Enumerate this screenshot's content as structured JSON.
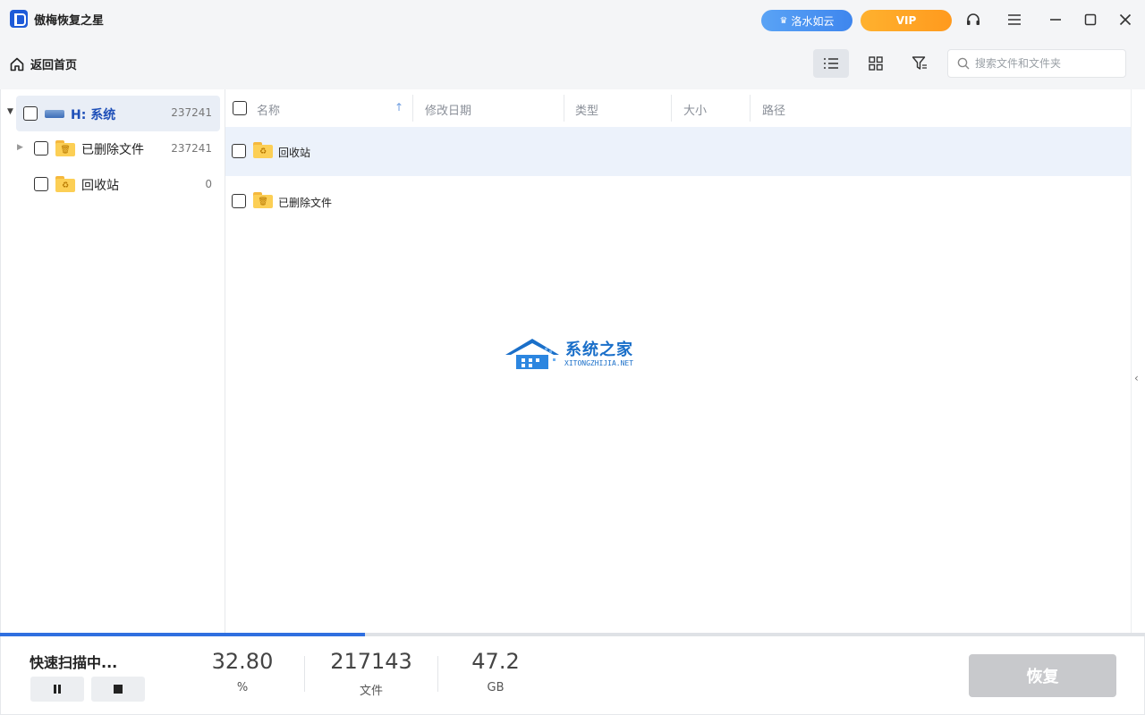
{
  "app": {
    "title": "傲梅恢复之星",
    "cloud_label": "洛水如云",
    "vip_label": "VIP"
  },
  "toolbar": {
    "home_label": "返回首页",
    "search_placeholder": "搜索文件和文件夹",
    "search_value": ""
  },
  "sidebar": {
    "drive": {
      "label": "H: 系统",
      "count": "237241"
    },
    "items": [
      {
        "label": "已删除文件",
        "count": "237241",
        "icon": "trash-folder-icon"
      },
      {
        "label": "回收站",
        "count": "0",
        "icon": "recycle-folder-icon"
      }
    ]
  },
  "filelist": {
    "columns": [
      "名称",
      "修改日期",
      "类型",
      "大小",
      "路径"
    ],
    "rows": [
      {
        "name": "回收站",
        "icon": "recycle-folder-icon"
      },
      {
        "name": "已删除文件",
        "icon": "trash-folder-icon"
      }
    ]
  },
  "watermark": {
    "cn": "系统之家",
    "en": "XITONGZHIJIA.NET"
  },
  "status": {
    "scan_label": "快速扫描中...",
    "progress_fraction": 0.319,
    "percent_value": "32.80",
    "percent_unit": "%",
    "files_value": "217143",
    "files_unit": "文件",
    "size_value": "47.2",
    "size_unit": "GB",
    "recover_label": "恢复"
  },
  "colors": {
    "accent": "#2f6fe0",
    "vip": "#ff9a1e",
    "cloud": "#3e86ee",
    "row_highlight": "#ecf2fb"
  }
}
